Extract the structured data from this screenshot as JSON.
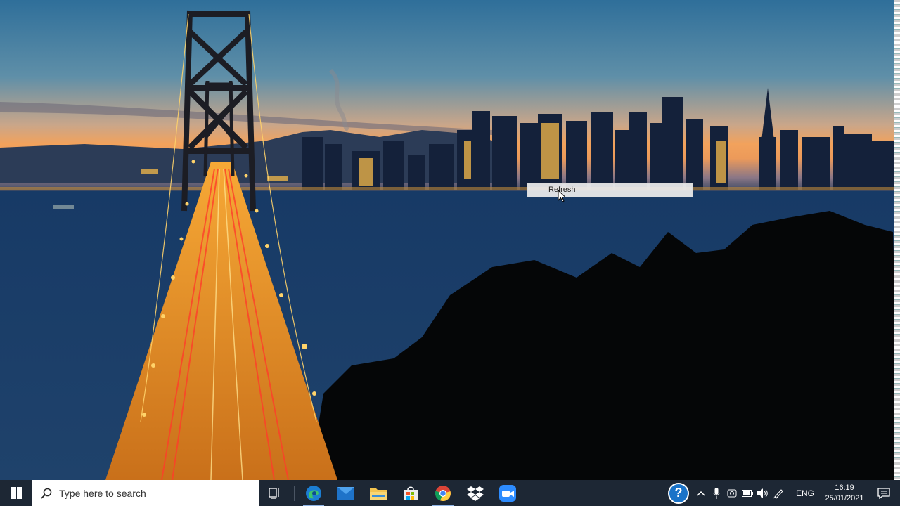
{
  "context_menu": {
    "refresh_label": "Refresh"
  },
  "taskbar": {
    "search_placeholder": "Type here to search",
    "apps": [
      "task-view",
      "edge",
      "mail",
      "file-explorer",
      "store",
      "chrome",
      "dropbox",
      "zoom"
    ],
    "tray": {
      "language": "ENG",
      "time": "16:19",
      "date": "25/01/2021"
    }
  },
  "colors": {
    "taskbar_bg": "#1d2734",
    "help_blue": "#1a73c8",
    "bridge_lights": "#f0a020"
  }
}
